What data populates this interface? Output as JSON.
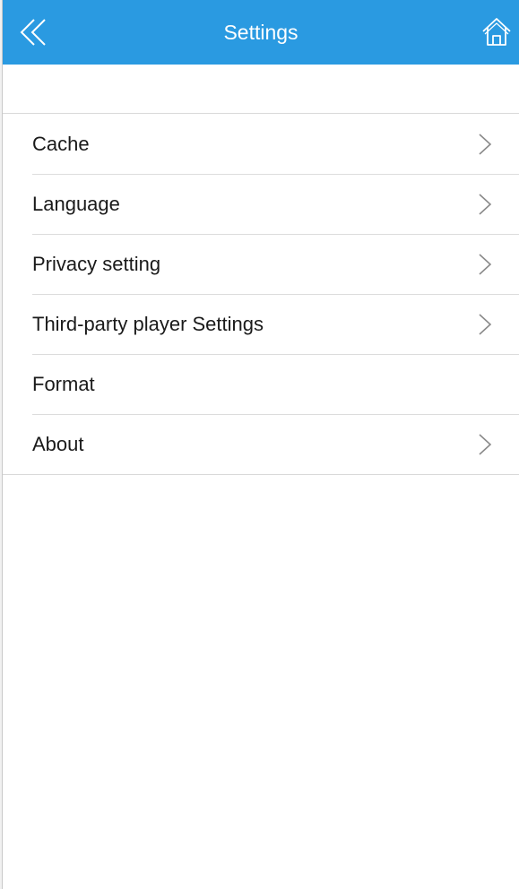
{
  "navbar": {
    "title": "Settings",
    "back_icon": "double-chevron-left-icon",
    "home_icon": "home-icon",
    "background_color": "#2a9ae1"
  },
  "settings": {
    "items": [
      {
        "label": "Cache",
        "has_chevron": true
      },
      {
        "label": "Language",
        "has_chevron": true
      },
      {
        "label": "Privacy setting",
        "has_chevron": true
      },
      {
        "label": "Third-party player Settings",
        "has_chevron": true
      },
      {
        "label": "Format",
        "has_chevron": false
      },
      {
        "label": "About",
        "has_chevron": true
      }
    ]
  }
}
